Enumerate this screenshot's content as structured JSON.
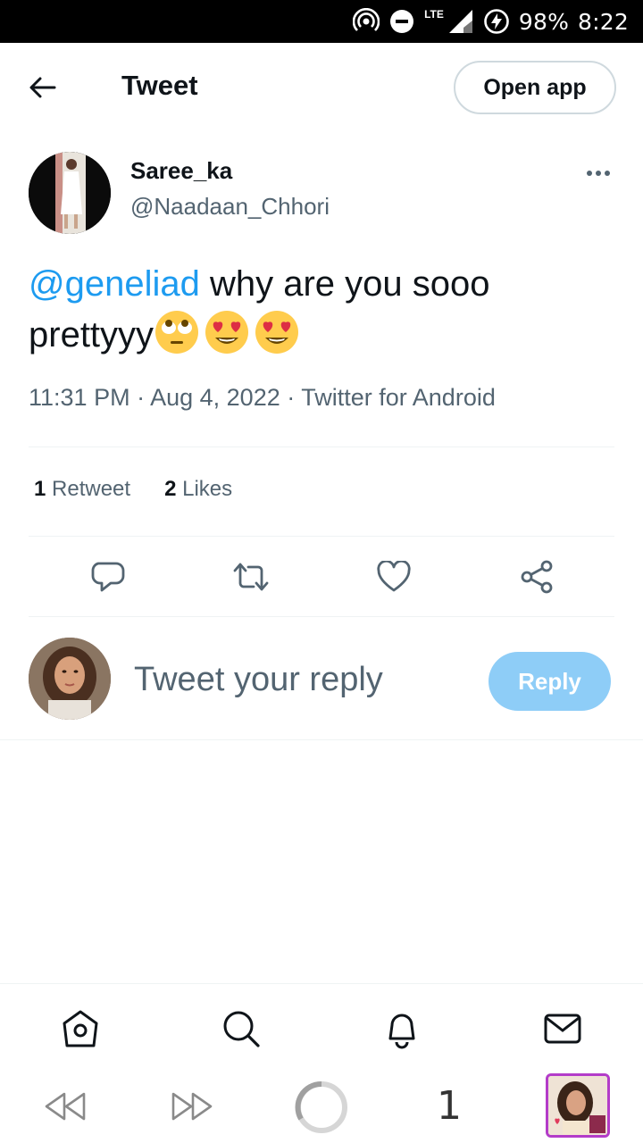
{
  "status_bar": {
    "battery": "98%",
    "time": "8:22",
    "network": "LTE",
    "icons": [
      "hotspot-icon",
      "do-not-disturb-icon",
      "signal-icon",
      "battery-saver-icon"
    ]
  },
  "header": {
    "title": "Tweet",
    "open_app_label": "Open app"
  },
  "tweet": {
    "author_name": "Saree_ka",
    "author_handle": "@Naadaan_Chhori",
    "mention": "@geneliad",
    "text_line1": " why are you sooo",
    "text_line2": "prettyyy",
    "emojis": [
      "face-with-rolling-eyes",
      "smiling-face-with-heart-eyes",
      "smiling-face-with-heart-eyes"
    ],
    "time": "11:31 PM",
    "date": "Aug 4, 2022",
    "source": "Twitter for Android",
    "separator": " · "
  },
  "stats": {
    "retweets_count": "1",
    "retweets_label": "Retweet",
    "likes_count": "2",
    "likes_label": "Likes"
  },
  "actions": [
    "reply-icon",
    "retweet-icon",
    "like-icon",
    "share-icon"
  ],
  "composer": {
    "placeholder": "Tweet your reply",
    "reply_label": "Reply"
  },
  "bottom_nav": [
    "home-icon",
    "search-icon",
    "notifications-icon",
    "messages-icon"
  ],
  "browser_bar": {
    "tab_count": "1"
  },
  "colors": {
    "accent": "#1d9bf0",
    "reply_button_disabled": "#8ecdf7",
    "secondary_text": "#536471",
    "tab_thumb_border": "#b33cc9"
  }
}
